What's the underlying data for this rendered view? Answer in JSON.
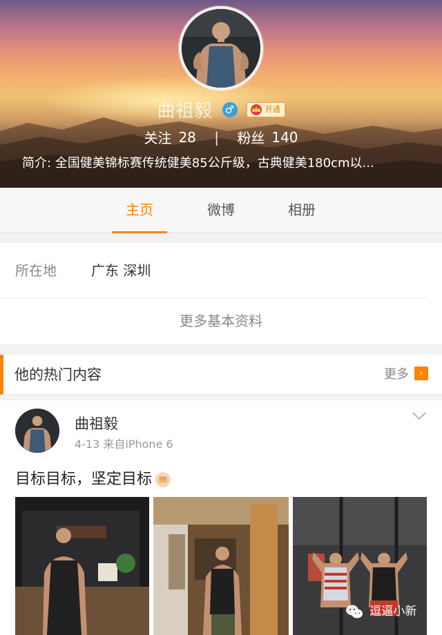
{
  "profile": {
    "name": "曲祖毅",
    "gender": "♂",
    "vip_label": "开通",
    "following_label": "关注",
    "following_count": "28",
    "separator": "|",
    "followers_label": "粉丝",
    "followers_count": "140",
    "bio": "简介: 全国健美锦标赛传统健美85公斤级，古典健美180cm以..."
  },
  "tabs": [
    {
      "label": "主页",
      "active": true
    },
    {
      "label": "微博",
      "active": false
    },
    {
      "label": "相册",
      "active": false
    }
  ],
  "info": {
    "location_label": "所在地",
    "location_value": "广东 深圳",
    "more_info": "更多基本资料"
  },
  "hot": {
    "title": "他的热门内容",
    "more": "更多",
    "more_arrow": "›"
  },
  "post": {
    "author": "曲祖毅",
    "meta": "4-13  来自iPhone 6",
    "text": "目标目标，坚定目标"
  },
  "watermark": "逗逼小新",
  "colors": {
    "accent": "#ff8200",
    "verified_blue": "#3aa0e0"
  }
}
